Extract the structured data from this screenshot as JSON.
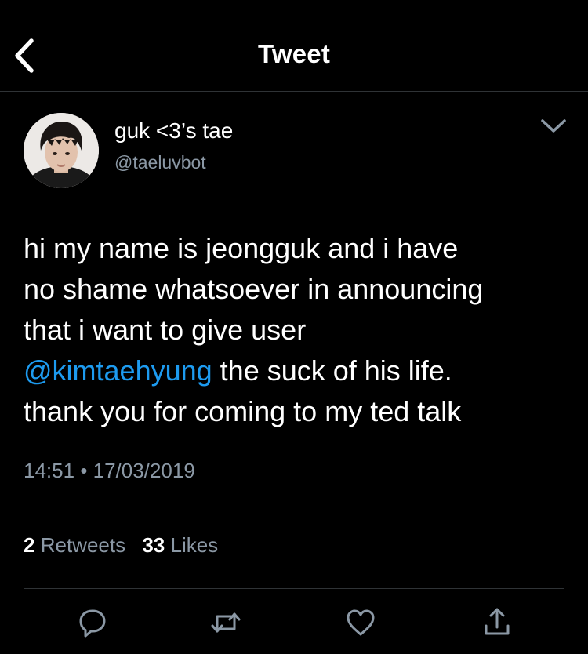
{
  "header": {
    "title": "Tweet",
    "back_icon": "chevron-left-icon"
  },
  "author": {
    "display_name": "guk <3’s tae",
    "handle": "@taeluvbot",
    "menu_icon": "chevron-down-icon"
  },
  "tweet": {
    "line1": "hi my name is jeongguk and i have",
    "line2": "no shame whatsoever in announcing",
    "line3": "that i want to give user",
    "mention": "@kimtaehyung",
    "line4_rest": " the suck of his life.",
    "line5": "thank you for coming to my ted talk",
    "time": "14:51",
    "separator": "•",
    "date": "17/03/2019"
  },
  "stats": {
    "retweets_count": "2",
    "retweets_label": "Retweets",
    "likes_count": "33",
    "likes_label": "Likes"
  },
  "actions": [
    {
      "icon": "reply-icon"
    },
    {
      "icon": "retweet-icon"
    },
    {
      "icon": "like-heart-icon"
    },
    {
      "icon": "share-icon"
    }
  ],
  "colors": {
    "background": "#000000",
    "text_primary": "#ffffff",
    "text_secondary": "#8b98a5",
    "link": "#1d9bf0",
    "divider": "#2f3336"
  }
}
